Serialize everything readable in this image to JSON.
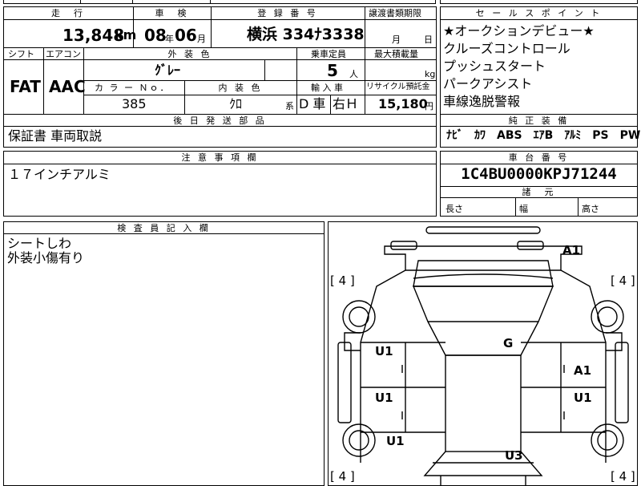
{
  "top_strip": {
    "label_left": "",
    "label_right": ""
  },
  "vehicle": {
    "mileage_label": "走　行",
    "mileage": "13,848",
    "mileage_unit": "km",
    "inspection_label": "車　検",
    "inspection_year": "08",
    "inspection_year_unit": "年",
    "inspection_month": "06",
    "inspection_month_unit": "月",
    "registration_label": "登 録 番 号",
    "registration": "横浜 334ﾅ3338",
    "transfer_label": "譲渡書類期限",
    "transfer_month_unit": "月",
    "transfer_day_unit": "日",
    "shift_label": "シフト",
    "shift": "FAT",
    "aircon_label": "エアコン",
    "aircon": "AAC",
    "exterior_color_label": "外 装 色",
    "exterior_color": "ｸﾞﾚｰ",
    "capacity_label": "乗車定員",
    "capacity": "5",
    "capacity_unit": "人",
    "max_load_label": "最大積載量",
    "max_load_unit": "kg",
    "color_no_label": "カ ラ ー Ｎｏ．",
    "color_no": "385",
    "interior_color_label": "内 装 色",
    "interior_color": "ｸﾛ",
    "interior_color_unit": "系",
    "import_label": "輸 入 車",
    "import_drive": "D 車",
    "import_steer": "右Ｈ",
    "recycle_label": "リサイクル預託金",
    "recycle": "15,180",
    "recycle_unit": "円"
  },
  "sales_points": {
    "title": "セ ー ル ス ポ イ ン ト",
    "items": [
      "★オークションデビュー★",
      "クルーズコントロール",
      "プッシュスタート",
      "パークアシスト",
      "車線逸脱警報"
    ]
  },
  "genuine_equipment": {
    "title": "純 正 装 備",
    "value": "ﾅﾋﾞ　ｶﾜ　ABS　ｴｱB　ｱﾙﾐ　PS　PW"
  },
  "later_parts": {
    "title": "後 日 発 送 部 品",
    "value": "保証書 車両取説"
  },
  "notes": {
    "title": "注 意 事 項 欄",
    "value": "１７インチアルミ"
  },
  "chassis": {
    "title": "車 台 番 号",
    "value": "1C4BU0000KPJ71244",
    "dims_title": "諸　元",
    "length_label": "長さ",
    "width_label": "幅",
    "height_label": "高さ"
  },
  "inspector": {
    "title": "検 査 員 記 入 欄",
    "lines": [
      "シートしわ",
      "外装小傷有り"
    ]
  },
  "diagram": {
    "marks": {
      "a1_top": "A1",
      "g": "G",
      "u1_left1": "U1",
      "u1_left2": "U1",
      "u1_left3": "U1",
      "a1_right": "A1",
      "u1_right": "U1",
      "u3": "U3"
    },
    "tires": {
      "front_left": "[ 4 ]",
      "front_right": "[ 4 ]",
      "rear_left": "[ 4 ]",
      "rear_right": "[ 4 ]"
    }
  }
}
